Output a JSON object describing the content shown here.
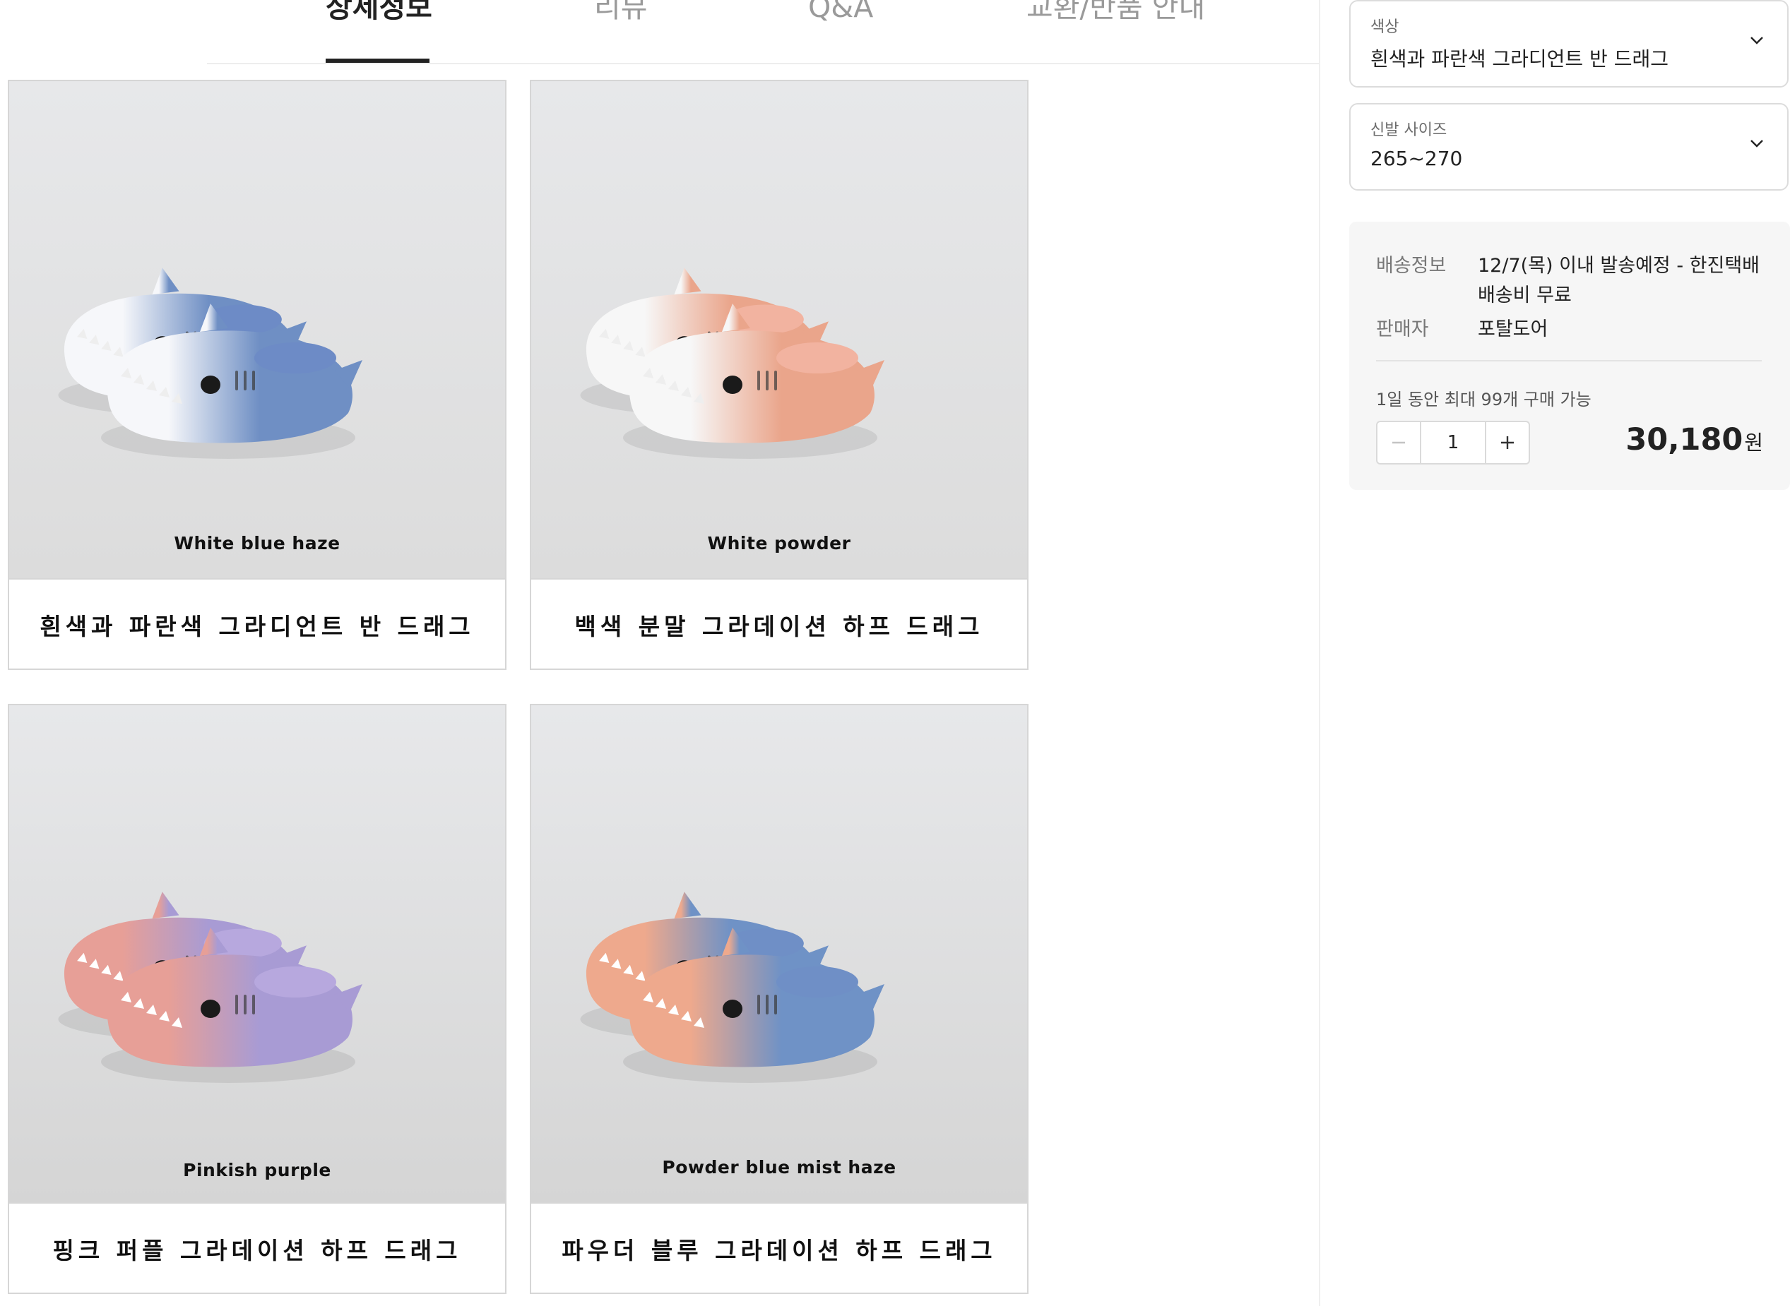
{
  "tabs": [
    {
      "label": "상세정보",
      "active": true
    },
    {
      "label": "리뷰",
      "active": false
    },
    {
      "label": "Q&A",
      "active": false
    },
    {
      "label": "교환/반품 안내",
      "active": false
    }
  ],
  "products": [
    {
      "caption": "White blue haze",
      "name": "흰색과 파란색 그라디언트 반 드래그",
      "colors": {
        "front": "#f6f7fa",
        "back": "#6f8fc4",
        "lining": "#6d8bc6"
      }
    },
    {
      "caption": "White powder",
      "name": "백색 분말 그라데이션 하프 드래그",
      "colors": {
        "front": "#f7f7f7",
        "back": "#eaa58b",
        "lining": "#f2b3a0"
      }
    },
    {
      "caption": "Pinkish purple",
      "name": "핑크 퍼플 그라데이션 하프 드래그",
      "colors": {
        "front": "#e79f97",
        "back": "#a89bd4",
        "lining": "#b7a8de"
      }
    },
    {
      "caption": "Powder blue mist haze",
      "name": "파우더 블루 그라데이션 하프 드래그",
      "colors": {
        "front": "#eea98d",
        "back": "#6f92c6",
        "lining": "#6f8fc6"
      }
    }
  ],
  "options": {
    "color": {
      "label": "색상",
      "value": "흰색과 파란색 그라디언트 반 드래그"
    },
    "size": {
      "label": "신발 사이즈",
      "value": "265~270"
    }
  },
  "shipping": {
    "label": "배송정보",
    "line1": "12/7(목) 이내 발송예정 - 한진택배",
    "line2": "배송비 무료"
  },
  "seller": {
    "label": "판매자",
    "value": "포탈도어"
  },
  "purchase_limit": "1일 동안 최대 99개 구매 가능",
  "quantity": "1",
  "price": {
    "amount": "30,180",
    "unit": "원"
  },
  "icons": {
    "chevron": "chevron-down-icon",
    "minus": "minus-icon",
    "plus": "plus-icon"
  }
}
